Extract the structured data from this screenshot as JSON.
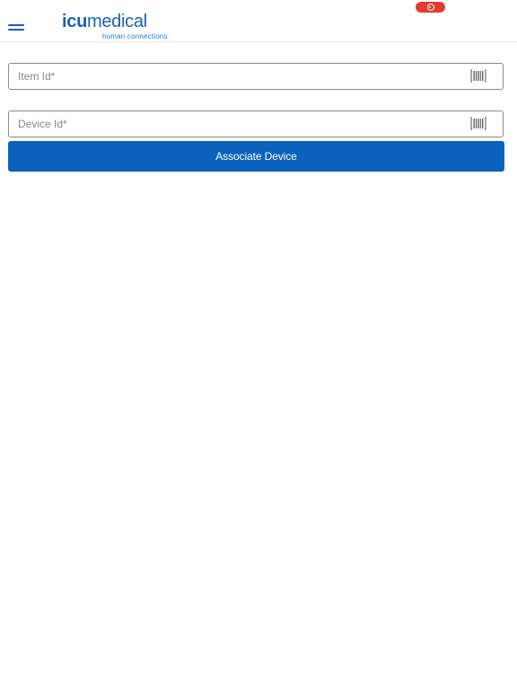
{
  "header": {
    "logo": {
      "bold": "icu",
      "light": "medical",
      "tagline": "human connections"
    },
    "menu_icon": "hamburger-menu-icon",
    "record_indicator_icon": "record-icon",
    "record_color": "#e23b2e"
  },
  "form": {
    "item_id": {
      "placeholder": "Item Id*",
      "value": "",
      "icon": "barcode-scan-icon"
    },
    "device_id": {
      "placeholder": "Device Id*",
      "value": "",
      "icon": "barcode-scan-icon"
    },
    "submit_label": "Associate Device"
  },
  "colors": {
    "brand_blue": "#1b5fb3",
    "button_blue": "#0a62bd",
    "field_border": "#8a8a8a"
  }
}
